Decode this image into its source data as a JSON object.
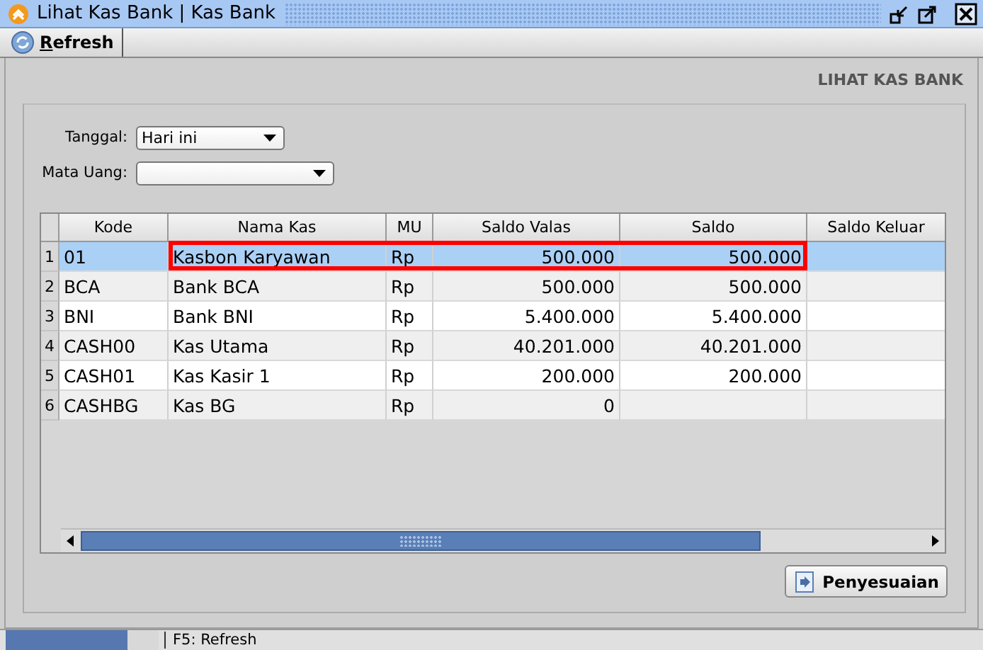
{
  "window": {
    "title": "Lihat Kas Bank | Kas Bank"
  },
  "toolbar": {
    "buttons": [
      {
        "label": "Refresh"
      }
    ]
  },
  "header": "LIHAT KAS BANK",
  "filters": [
    {
      "label": "Tanggal:",
      "value": "Hari ini",
      "kind": "short"
    },
    {
      "label": "Mata Uang:",
      "kind": "long"
    }
  ],
  "table": {
    "columns": [
      "Kode",
      "Nama Kas",
      "MU",
      "Saldo Valas",
      "Saldo",
      "Saldo Keluar"
    ],
    "rows": [
      {
        "number": "1",
        "selected": true,
        "highlighted": true,
        "cells": [
          "01",
          "Kasbon Karyawan",
          "Rp",
          "500.000",
          "500.000",
          ""
        ]
      },
      {
        "number": "2",
        "selected": false,
        "highlighted": false,
        "cells": [
          "BCA",
          "Bank BCA",
          "Rp",
          "500.000",
          "500.000",
          ""
        ]
      },
      {
        "number": "3",
        "selected": false,
        "highlighted": false,
        "cells": [
          "BNI",
          "Bank BNI",
          "Rp",
          "5.400.000",
          "5.400.000",
          ""
        ]
      },
      {
        "number": "4",
        "selected": false,
        "highlighted": false,
        "cells": [
          "CASH00",
          "Kas Utama",
          "Rp",
          "40.201.000",
          "40.201.000",
          ""
        ]
      },
      {
        "number": "5",
        "selected": false,
        "highlighted": false,
        "cells": [
          "CASH01",
          "Kas Kasir 1",
          "Rp",
          "200.000",
          "200.000",
          ""
        ]
      },
      {
        "number": "6",
        "selected": false,
        "highlighted": false,
        "cells": [
          "CASHBG",
          "Kas BG",
          "Rp",
          "0",
          "",
          ""
        ]
      }
    ]
  },
  "action_button": "Penyesuaian",
  "status_bar": {
    "progress": {
      "level": 0.8
    },
    "text": "F5: Refresh"
  }
}
